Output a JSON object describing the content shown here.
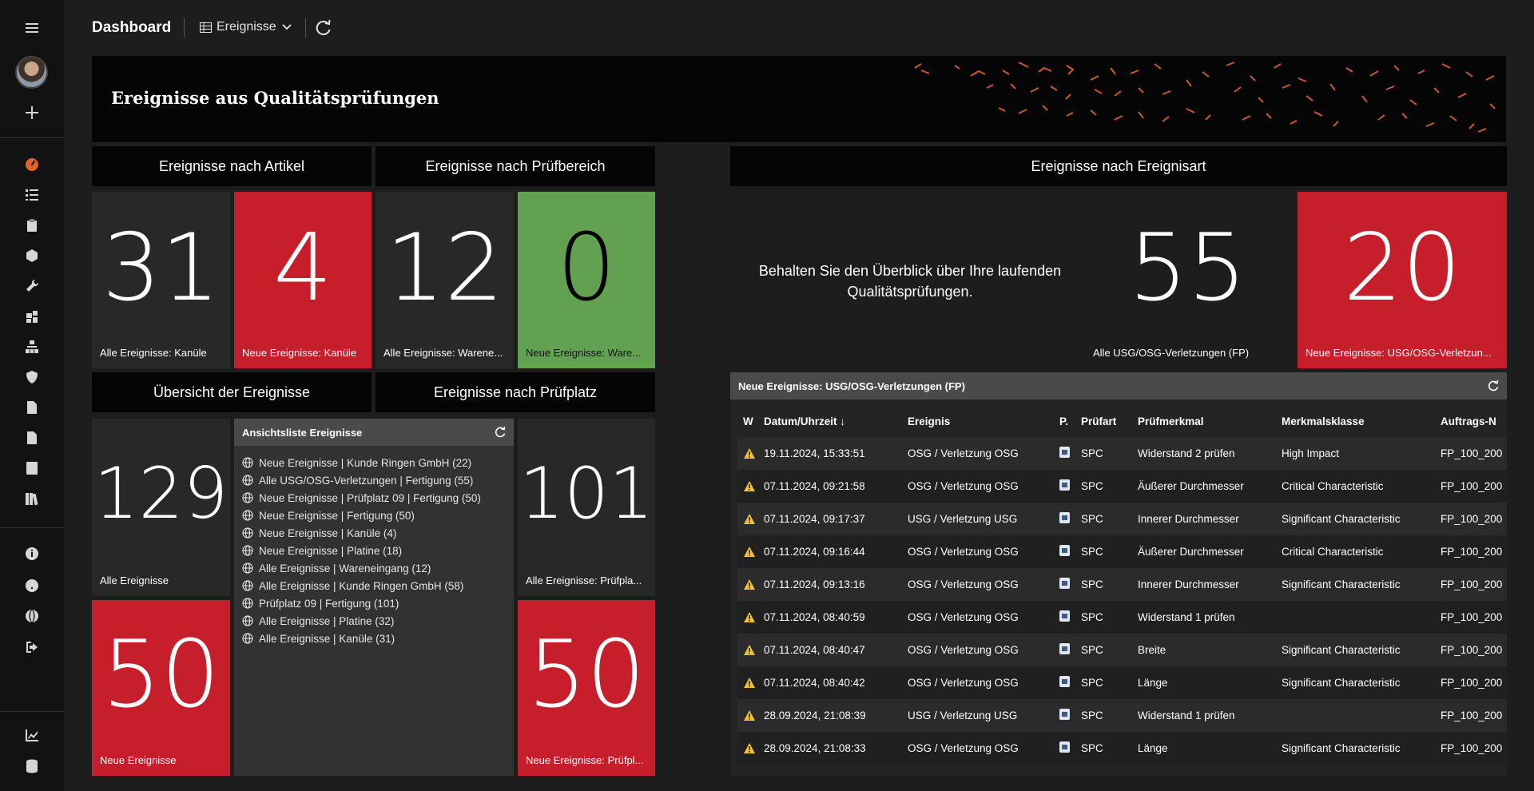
{
  "sidebar": {
    "icons": [
      "menu-icon",
      "avatar",
      "plus-icon",
      "dashboard-gauge-icon",
      "task-list-icon",
      "clipboard-icon",
      "cubes-icon",
      "wrench-icon",
      "puzzle-icon",
      "sitemap-icon",
      "shield-icon",
      "file-check-icon",
      "file-user-icon",
      "list-icon",
      "books-icon",
      "info-icon",
      "help-icon",
      "globe-icon",
      "logout-icon",
      "chart-icon",
      "database-icon"
    ]
  },
  "header": {
    "title": "Dashboard",
    "view_label": "Ereignisse"
  },
  "banner": {
    "title": "Ereignisse aus Qualitätsprüfungen"
  },
  "sections": {
    "artikel": "Ereignisse nach Artikel",
    "pruefbereich": "Ereignisse nach Prüfbereich",
    "ereignisart": "Ereignisse nach Ereignisart",
    "uebersicht": "Übersicht der Ereignisse",
    "pruefplatz": "Ereignisse nach Prüfplatz"
  },
  "tiles": {
    "artikel_all": {
      "value": "31",
      "label": "Alle Ereignisse: Kanüle"
    },
    "artikel_new": {
      "value": "4",
      "label": "Neue Ereignisse: Kanüle"
    },
    "bereich_all": {
      "value": "12",
      "label": "Alle Ereignisse: Warene..."
    },
    "bereich_new": {
      "value": "0",
      "label": "Neue Ereignisse: Ware..."
    },
    "art_all": {
      "value": "55",
      "label": "Alle USG/OSG-Verletzungen (FP)"
    },
    "art_new": {
      "value": "20",
      "label": "Neue Ereignisse: USG/OSG-Verletzun..."
    },
    "ueb_all": {
      "value": "129",
      "label": "Alle Ereignisse"
    },
    "ueb_new": {
      "value": "50",
      "label": "Neue Ereignisse"
    },
    "platz_all": {
      "value": "101",
      "label": "Alle Ereignisse: Prüfpla..."
    },
    "platz_new": {
      "value": "50",
      "label": "Neue Ereignisse: Prüfpl..."
    }
  },
  "info_text": "Behalten Sie den Überblick über Ihre laufenden Qualitätsprüfungen.",
  "list_panel": {
    "title": "Ansichtsliste Ereignisse",
    "items": [
      "Neue Ereignisse | Kunde Ringen GmbH (22)",
      "Alle USG/OSG-Verletzungen | Fertigung (55)",
      "Neue Ereignisse | Prüfplatz 09 | Fertigung (50)",
      "Neue Ereignisse | Fertigung (50)",
      "Neue Ereignisse | Kanüle (4)",
      "Neue Ereignisse | Platine (18)",
      "Alle Ereignisse | Wareneingang (12)",
      "Alle Ereignisse | Kunde Ringen GmbH (58)",
      "Prüfplatz 09 | Fertigung (101)",
      "Alle Ereignisse | Platine (32)",
      "Alle Ereignisse | Kanüle (31)"
    ]
  },
  "table_panel": {
    "title": "Neue Ereignisse: USG/OSG-Verletzungen (FP)",
    "columns": [
      "W",
      "Datum/Uhrzeit ↓",
      "Ereignis",
      "P.",
      "Prüfart",
      "Prüfmerkmal",
      "Merkmalsklasse",
      "Auftrags-N"
    ],
    "rows": [
      [
        "19.11.2024, 15:33:51",
        "OSG / Verletzung OSG",
        "SPC",
        "Widerstand 2 prüfen",
        "High Impact",
        "FP_100_200"
      ],
      [
        "07.11.2024, 09:21:58",
        "OSG / Verletzung OSG",
        "SPC",
        "Äußerer Durchmesser",
        "Critical Characteristic",
        "FP_100_200"
      ],
      [
        "07.11.2024, 09:17:37",
        "USG / Verletzung USG",
        "SPC",
        "Innerer Durchmesser",
        "Significant Characteristic",
        "FP_100_200"
      ],
      [
        "07.11.2024, 09:16:44",
        "OSG / Verletzung OSG",
        "SPC",
        "Äußerer Durchmesser",
        "Critical Characteristic",
        "FP_100_200"
      ],
      [
        "07.11.2024, 09:13:16",
        "OSG / Verletzung OSG",
        "SPC",
        "Innerer Durchmesser",
        "Significant Characteristic",
        "FP_100_200"
      ],
      [
        "07.11.2024, 08:40:59",
        "OSG / Verletzung OSG",
        "SPC",
        "Widerstand 1 prüfen",
        "",
        "FP_100_200"
      ],
      [
        "07.11.2024, 08:40:47",
        "OSG / Verletzung OSG",
        "SPC",
        "Breite",
        "Significant Characteristic",
        "FP_100_200"
      ],
      [
        "07.11.2024, 08:40:42",
        "OSG / Verletzung OSG",
        "SPC",
        "Länge",
        "Significant Characteristic",
        "FP_100_200"
      ],
      [
        "28.09.2024, 21:08:39",
        "USG / Verletzung USG",
        "SPC",
        "Widerstand 1 prüfen",
        "",
        "FP_100_200"
      ],
      [
        "28.09.2024, 21:08:33",
        "OSG / Verletzung OSG",
        "SPC",
        "Länge",
        "Significant Characteristic",
        "FP_100_200"
      ]
    ]
  },
  "colors": {
    "red": "#c61f2b",
    "green": "#62a052",
    "accent_orange": "#e0642a",
    "warning_yellow": "#f2c12e"
  }
}
